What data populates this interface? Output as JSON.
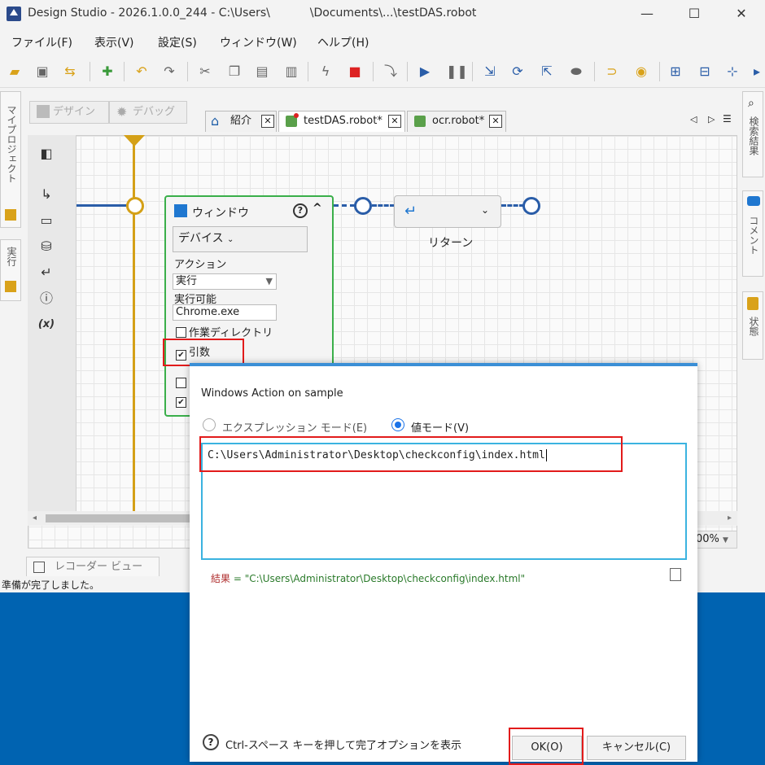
{
  "window": {
    "title": "Design Studio - 2026.1.0.0_244 - C:\\Users\\           \\Documents\\...\\testDAS.robot",
    "controls": {
      "minimize": "—",
      "maximize": "☐",
      "close": "✕"
    }
  },
  "menu": [
    "ファイル(F)",
    "表示(V)",
    "設定(S)",
    "ウィンドウ(W)",
    "ヘルプ(H)"
  ],
  "left_tabs": {
    "project": "マイプロジェクト",
    "run": "実行"
  },
  "right_tabs": {
    "search": "検索結果",
    "comment": "コメント",
    "state": "状態"
  },
  "modes": {
    "design": "デザイン",
    "debug": "デバッグ"
  },
  "editor_tabs": [
    {
      "label": "紹介",
      "close": "✕"
    },
    {
      "label": "testDAS.robot*",
      "close": "✕"
    },
    {
      "label": "ocr.robot*",
      "close": "✕"
    }
  ],
  "tab_nav": {
    "left": "◁",
    "right": "▷",
    "menu": "☰"
  },
  "window_step": {
    "title": "ウィンドウ",
    "help": "?",
    "collapse": "^",
    "device": "デバイス",
    "action_label": "アクション",
    "action_value": "実行",
    "executable_label": "実行可能",
    "executable_value": "Chrome.exe",
    "workdir_label": "作業ディレクトリ",
    "args_label": "引数"
  },
  "return_step": {
    "label": "リターン",
    "icon": "↵"
  },
  "zoom": "00%",
  "recorder_view": "レコーダー ビュー",
  "status": "準備が完了しました。",
  "dialog": {
    "title": "Windows Action on sample",
    "expr_mode": "エクスプレッション モード(E)",
    "value_mode": "値モード(V)",
    "value": "C:\\Users\\Administrator\\Desktop\\checkconfig\\index.html",
    "result_label": "結果",
    "result_value": "= \"C:\\Users\\Administrator\\Desktop\\checkconfig\\index.html\"",
    "hint": "Ctrl-スペース キーを押して完了オプションを表示",
    "ok": "OK(O)",
    "cancel": "キャンセル(C)"
  },
  "colors": {
    "accent_blue": "#2a5da8",
    "flow_yellow": "#d4a017",
    "card_green": "#3aaf4a",
    "highlight_red": "#e21b1b",
    "desktop_blue": "#0063b1"
  }
}
